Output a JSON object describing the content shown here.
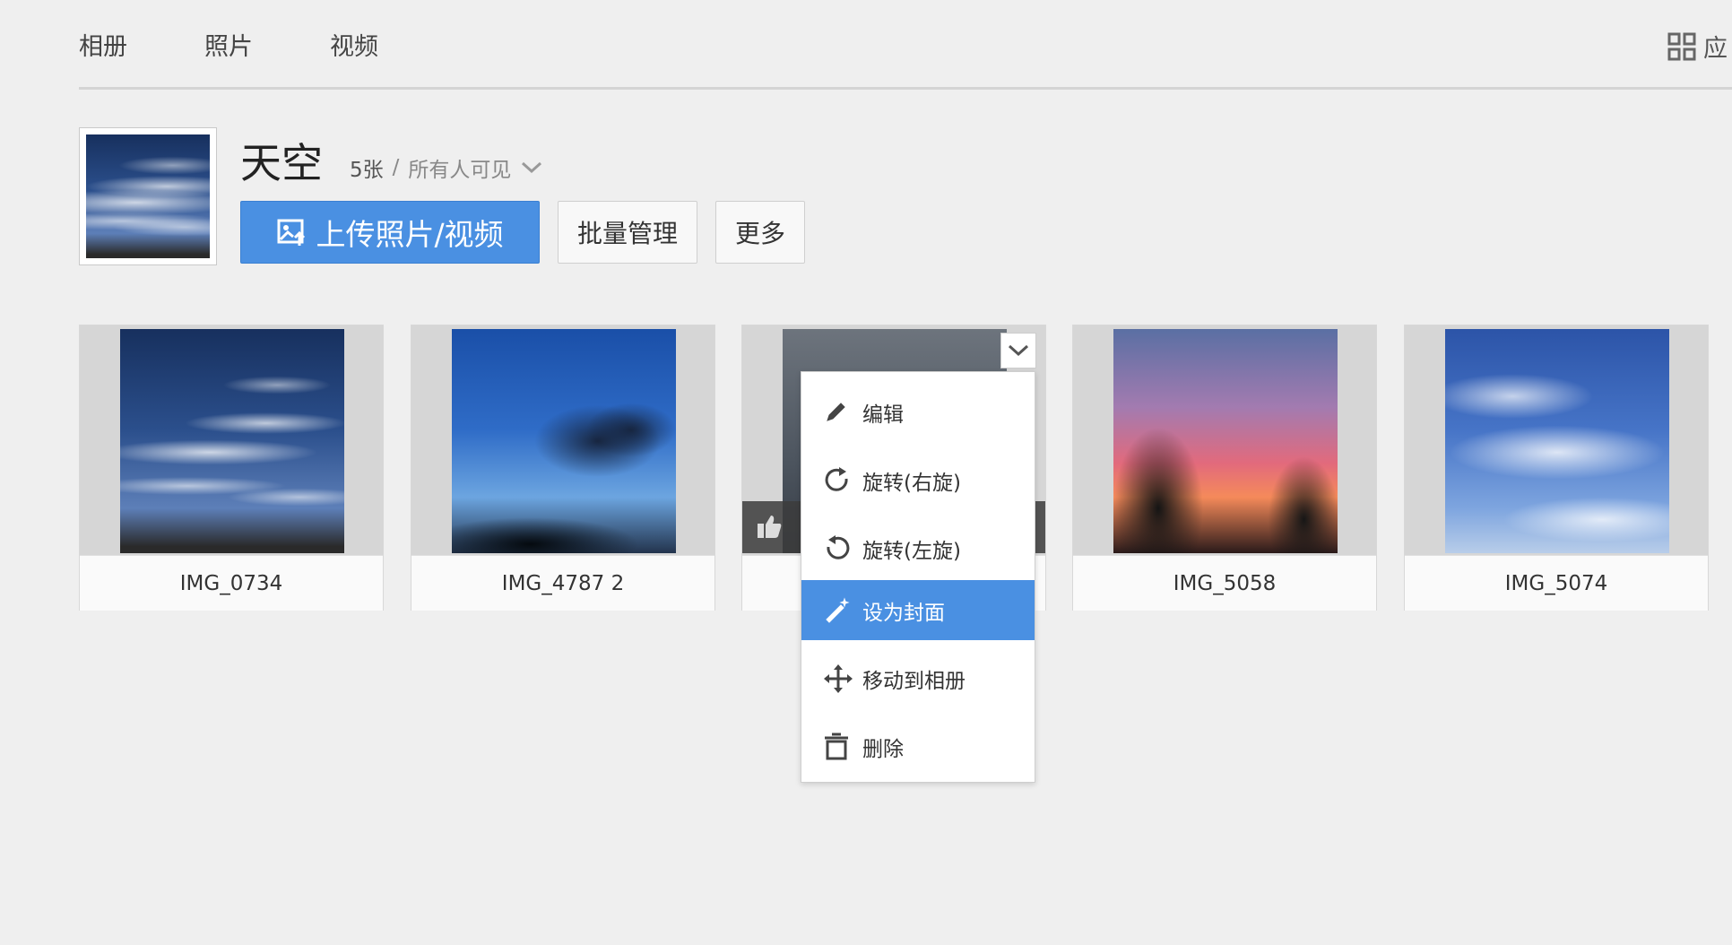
{
  "nav": {
    "tabs": [
      {
        "label": "相册"
      },
      {
        "label": "照片"
      },
      {
        "label": "视频"
      }
    ],
    "apps_label": "应"
  },
  "album": {
    "title": "天空",
    "count": "5张",
    "separator": "/",
    "visibility": "所有人可见",
    "upload_label": "上传照片/视频",
    "batch_label": "批量管理",
    "more_label": "更多"
  },
  "photos": [
    {
      "name": "IMG_0734"
    },
    {
      "name": "IMG_4787 2"
    },
    {
      "name": ""
    },
    {
      "name": "IMG_5058"
    },
    {
      "name": "IMG_5074"
    }
  ],
  "context_menu": {
    "items": [
      {
        "label": "编辑",
        "icon": "pencil-icon"
      },
      {
        "label": "旋转(右旋)",
        "icon": "rotate-right-icon"
      },
      {
        "label": "旋转(左旋)",
        "icon": "rotate-left-icon"
      },
      {
        "label": "设为封面",
        "icon": "magic-wand-icon",
        "highlighted": true
      },
      {
        "label": "移动到相册",
        "icon": "move-icon"
      },
      {
        "label": "删除",
        "icon": "trash-icon"
      }
    ]
  },
  "colors": {
    "accent": "#4a90e2",
    "background": "#efefef"
  }
}
